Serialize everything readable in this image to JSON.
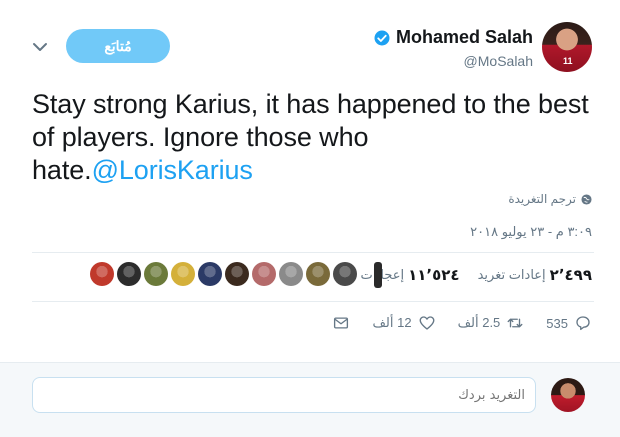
{
  "header": {
    "follow_label": "مُتابَع",
    "display_name": "Mohamed Salah",
    "handle": "@MoSalah",
    "avatar_number": "11"
  },
  "tweet": {
    "text": "Stay strong Karius, it has happened to the best of players. Ignore those who hate.",
    "mention": "@LorisKarius"
  },
  "translate_label": "ترجم التغريدة",
  "timestamp": "٣:٠٩ م - ٢٣ يوليو ٢٠١٨",
  "stats": {
    "retweets_count": "٢٬٤٩٩",
    "retweets_label": "إعادات تغريد",
    "likes_count": "١١٬٥٢٤",
    "likes_label": "إعجابات"
  },
  "liker_avatars": [
    {
      "name": "liker-1",
      "color": "#c0392b"
    },
    {
      "name": "liker-2",
      "color": "#2c2c2c"
    },
    {
      "name": "liker-3",
      "color": "#6b7a3a"
    },
    {
      "name": "liker-4",
      "color": "#d4b03a"
    },
    {
      "name": "liker-5",
      "color": "#2b3a66"
    },
    {
      "name": "liker-6",
      "color": "#3b2a1e"
    },
    {
      "name": "liker-7",
      "color": "#b46a6a"
    },
    {
      "name": "liker-8",
      "color": "#8a8a8a"
    },
    {
      "name": "liker-9",
      "color": "#7a6a3a"
    },
    {
      "name": "liker-10",
      "color": "#4a4a4a"
    }
  ],
  "actions": {
    "replies": "535",
    "retweets": "2.5 ألف",
    "likes": "12 ألف"
  },
  "reply": {
    "placeholder": "التغريد بردك"
  },
  "colors": {
    "accent": "#1da1f2",
    "follow_button": "#71c9f8",
    "muted": "#657786"
  }
}
